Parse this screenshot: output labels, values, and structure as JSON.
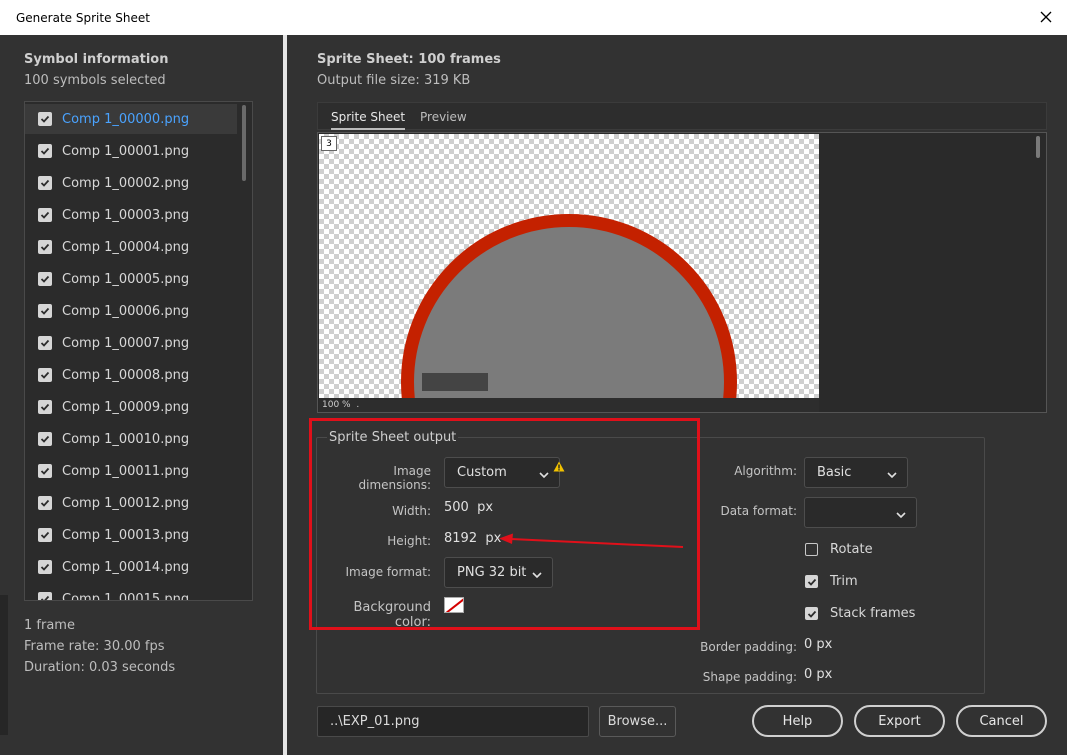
{
  "window": {
    "title": "Generate Sprite Sheet"
  },
  "symbol_info": {
    "heading": "Symbol information",
    "selected": "100 symbols selected",
    "items": [
      {
        "label": "Comp 1_00000.png",
        "checked": true,
        "selected": true
      },
      {
        "label": "Comp 1_00001.png",
        "checked": true
      },
      {
        "label": "Comp 1_00002.png",
        "checked": true
      },
      {
        "label": "Comp 1_00003.png",
        "checked": true
      },
      {
        "label": "Comp 1_00004.png",
        "checked": true
      },
      {
        "label": "Comp 1_00005.png",
        "checked": true
      },
      {
        "label": "Comp 1_00006.png",
        "checked": true
      },
      {
        "label": "Comp 1_00007.png",
        "checked": true
      },
      {
        "label": "Comp 1_00008.png",
        "checked": true
      },
      {
        "label": "Comp 1_00009.png",
        "checked": true
      },
      {
        "label": "Comp 1_00010.png",
        "checked": true
      },
      {
        "label": "Comp 1_00011.png",
        "checked": true
      },
      {
        "label": "Comp 1_00012.png",
        "checked": true
      },
      {
        "label": "Comp 1_00013.png",
        "checked": true
      },
      {
        "label": "Comp 1_00014.png",
        "checked": true
      },
      {
        "label": "Comp 1_00015.png",
        "checked": true
      }
    ],
    "frame_count": "1 frame",
    "frame_rate": "Frame rate: 30.00 fps",
    "duration": "Duration: 0.03 seconds"
  },
  "sprite_sheet": {
    "heading": "Sprite Sheet: 100 frames",
    "file_size": "Output file size: 319 KB",
    "tabs": [
      {
        "label": "Sprite Sheet",
        "active": true
      },
      {
        "label": "Preview",
        "active": false
      }
    ],
    "frame_badge": "3",
    "zoom": "100 %"
  },
  "output": {
    "title": "Sprite Sheet output",
    "image_dimensions_label": "Image dimensions:",
    "image_dimensions_value": "Custom",
    "width_label": "Width:",
    "width_value": "500",
    "height_label": "Height:",
    "height_value": "8192",
    "unit": "px",
    "image_format_label": "Image format:",
    "image_format_value": "PNG 32 bit",
    "background_color_label": "Background color:",
    "algorithm_label": "Algorithm:",
    "algorithm_value": "Basic",
    "data_format_label": "Data format:",
    "data_format_value": "",
    "rotate": {
      "label": "Rotate",
      "checked": false
    },
    "trim": {
      "label": "Trim",
      "checked": true
    },
    "stack_frames": {
      "label": "Stack frames",
      "checked": true
    },
    "border_padding_label": "Border padding:",
    "border_padding_value": "0",
    "shape_padding_label": "Shape padding:",
    "shape_padding_value": "0"
  },
  "footer": {
    "path": "..\\EXP_01.png",
    "browse": "Browse...",
    "help": "Help",
    "export": "Export",
    "cancel": "Cancel"
  },
  "colors": {
    "accent_blue": "#4aa3ff",
    "highlight_red": "#e0101a",
    "sprite_ring": "#c42100",
    "sprite_fill": "#7b7b7b"
  }
}
